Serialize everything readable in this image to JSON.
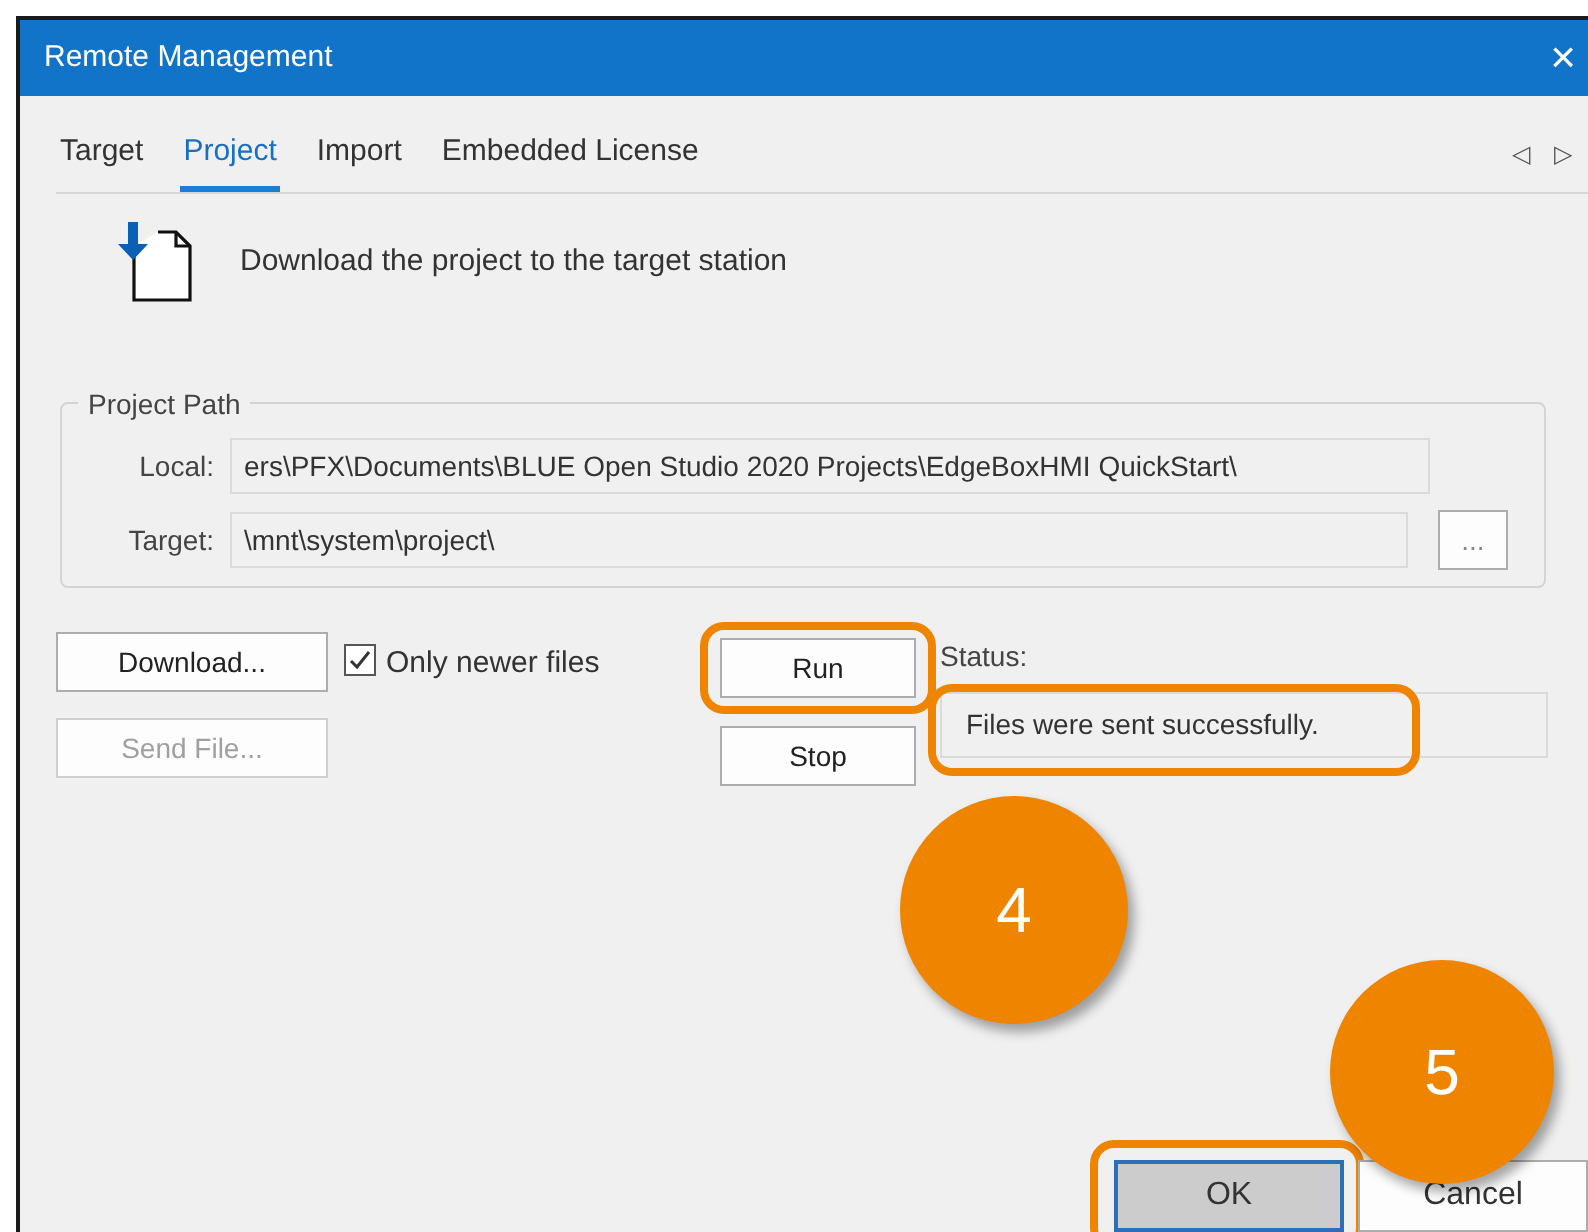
{
  "window": {
    "title": "Remote Management",
    "close": "×"
  },
  "tabs": [
    {
      "label": "Target",
      "selected": false
    },
    {
      "label": "Project",
      "selected": true
    },
    {
      "label": "Import",
      "selected": false
    },
    {
      "label": "Embedded License",
      "selected": false
    }
  ],
  "tab_scroll": [
    "◁",
    "▷"
  ],
  "header": {
    "text": "Download the project to the target station"
  },
  "project_path": {
    "legend": "Project Path",
    "local": {
      "label": "Local:",
      "value": "ers\\PFX\\Documents\\BLUE Open Studio 2020 Projects\\EdgeBoxHMI QuickStart\\"
    },
    "target": {
      "label": "Target:",
      "value": "\\mnt\\system\\project\\"
    },
    "browse": "..."
  },
  "download": {
    "label": "Download...",
    "disabled": false
  },
  "send_file": {
    "label": "Send File...",
    "disabled": true
  },
  "only_newer": {
    "label": "Only newer files",
    "checked": true
  },
  "run": {
    "label": "Run",
    "highlighted": true
  },
  "stop": {
    "label": "Stop",
    "highlighted": false
  },
  "status": {
    "label": "Status:",
    "value": "Files were sent successfully.",
    "highlighted": true
  },
  "footer": [
    {
      "label": "OK",
      "default": true,
      "highlighted": true
    },
    {
      "label": "Cancel",
      "default": false,
      "highlighted": false
    }
  ],
  "callouts": [
    "4",
    "5"
  ]
}
